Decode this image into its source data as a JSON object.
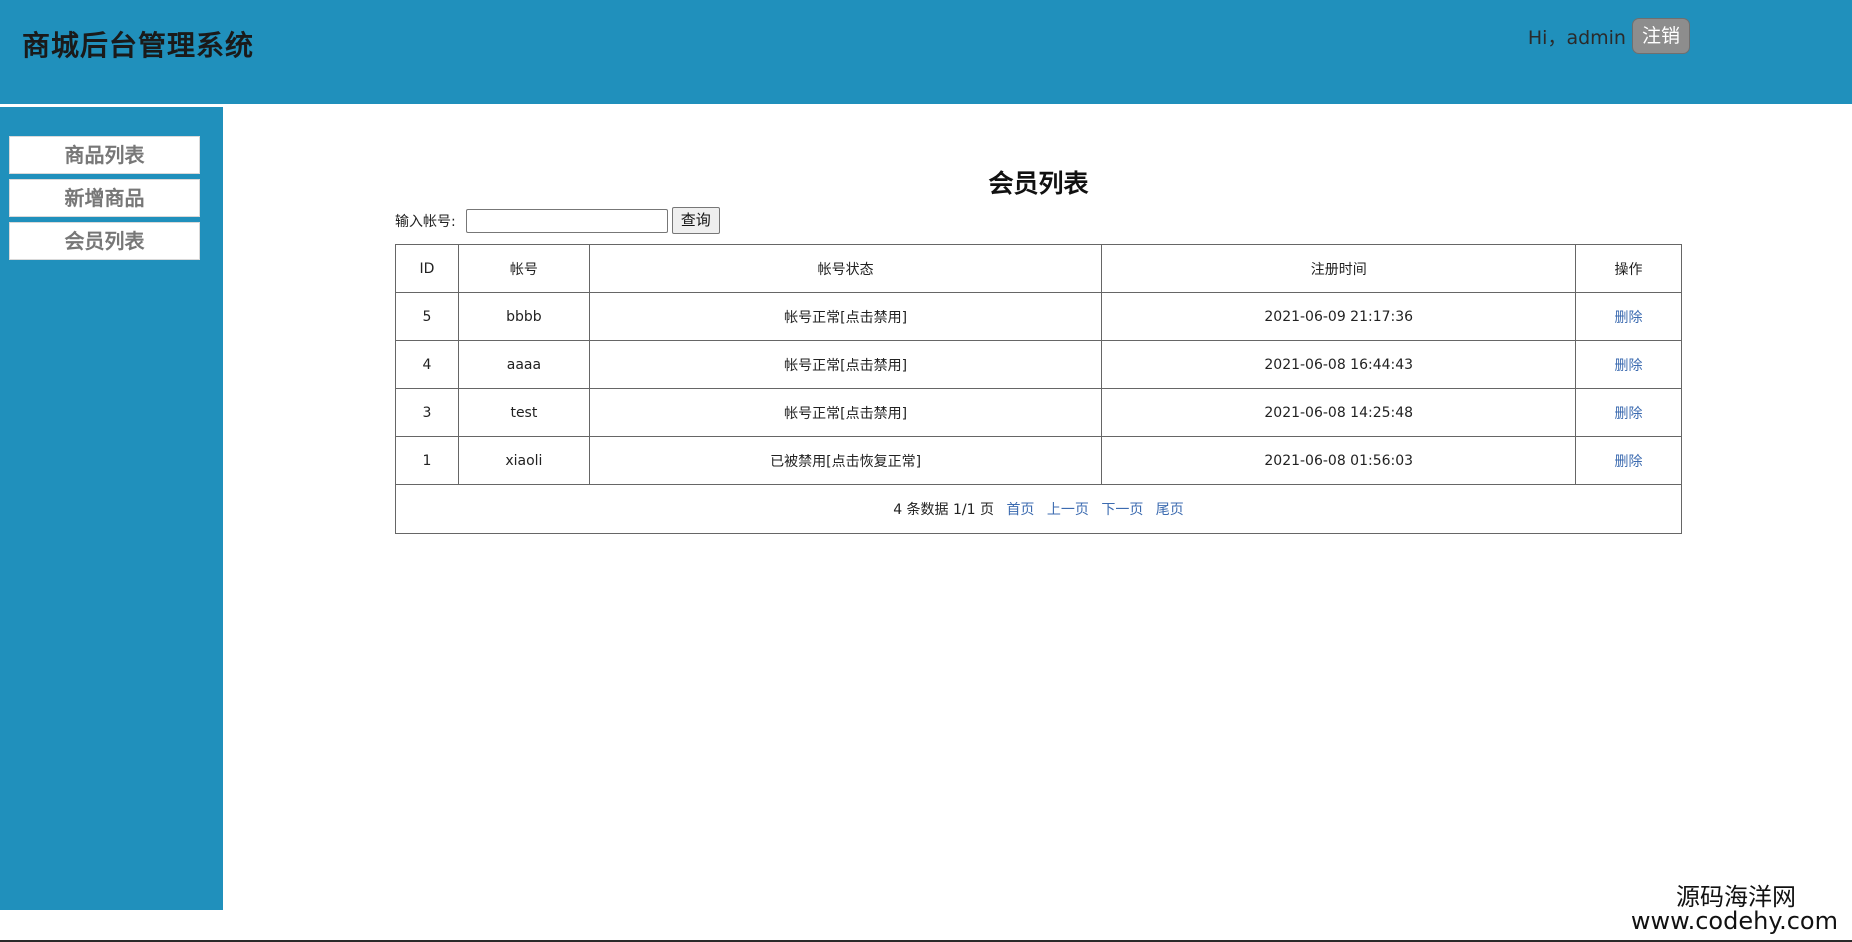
{
  "header": {
    "title": "商城后台管理系统",
    "greeting": "Hi，admin",
    "logout_label": "注销"
  },
  "sidebar": {
    "items": [
      {
        "label": "商品列表"
      },
      {
        "label": "新增商品"
      },
      {
        "label": "会员列表"
      }
    ]
  },
  "main": {
    "title": "会员列表",
    "search": {
      "label": "输入帐号:",
      "value": "",
      "placeholder": "",
      "button_label": "查询"
    },
    "table": {
      "columns": [
        "ID",
        "帐号",
        "帐号状态",
        "注册时间",
        "操作"
      ],
      "rows": [
        {
          "id": "5",
          "account": "bbbb",
          "status": "帐号正常[点击禁用]",
          "time": "2021-06-09 21:17:36",
          "action": "删除"
        },
        {
          "id": "4",
          "account": "aaaa",
          "status": "帐号正常[点击禁用]",
          "time": "2021-06-08 16:44:43",
          "action": "删除"
        },
        {
          "id": "3",
          "account": "test",
          "status": "帐号正常[点击禁用]",
          "time": "2021-06-08 14:25:48",
          "action": "删除"
        },
        {
          "id": "1",
          "account": "xiaoli",
          "status": "已被禁用[点击恢复正常]",
          "time": "2021-06-08 01:56:03",
          "action": "删除"
        }
      ]
    },
    "pager": {
      "summary": "4 条数据 1/1 页",
      "first": "首页",
      "prev": "上一页",
      "next": "下一页",
      "last": "尾页"
    }
  },
  "watermark": {
    "line1": "源码海洋网",
    "line2": "www.codehy.com"
  },
  "colors": {
    "accent": "#2090bc",
    "link": "#3c6bb0",
    "logout_bg": "#8d8d8d"
  }
}
